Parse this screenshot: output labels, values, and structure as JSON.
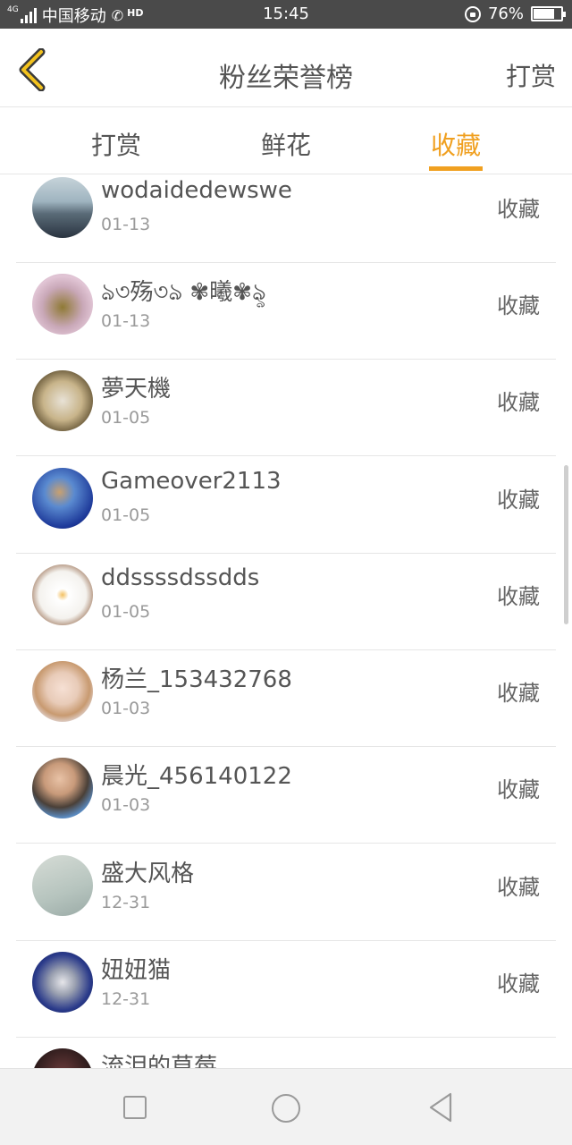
{
  "status_bar": {
    "network_tag": "4G",
    "carrier": "中国移动",
    "hd": "HD",
    "time": "15:45",
    "battery": "76%",
    "battery_level": 0.76
  },
  "header": {
    "title": "粉丝荣誉榜",
    "right_action": "打赏",
    "back_icon": "chevron-left-icon",
    "accent": "#f0a020"
  },
  "tabs": [
    {
      "label": "打赏",
      "active": false
    },
    {
      "label": "鲜花",
      "active": false
    },
    {
      "label": "收藏",
      "active": true
    }
  ],
  "list": [
    {
      "name": "wodaidedewswe",
      "date": "01-13",
      "action": "收藏"
    },
    {
      "name": "ঌ৩殇৩ঌ ✾曦✾ৡ",
      "date": "01-13",
      "action": "收藏"
    },
    {
      "name": "夢天機",
      "date": "01-05",
      "action": "收藏"
    },
    {
      "name": "Gameover2113",
      "date": "01-05",
      "action": "收藏"
    },
    {
      "name": "ddssssdssdds",
      "date": "01-05",
      "action": "收藏"
    },
    {
      "name": "杨兰_153432768",
      "date": "01-03",
      "action": "收藏"
    },
    {
      "name": "晨光_456140122",
      "date": "01-03",
      "action": "收藏"
    },
    {
      "name": "盛大风格",
      "date": "12-31",
      "action": "收藏"
    },
    {
      "name": "妞妞猫",
      "date": "12-31",
      "action": "收藏"
    },
    {
      "name": "流泪的草莓",
      "date": "",
      "action": ""
    }
  ],
  "navbar": {
    "icons": [
      "square-recents-icon",
      "circle-home-icon",
      "triangle-back-icon"
    ]
  }
}
